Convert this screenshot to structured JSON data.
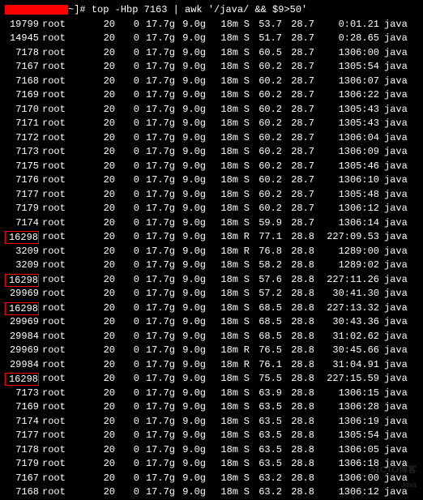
{
  "prompt": {
    "suffix": "~]#",
    "command": "top  -Hbp 7163 | awk '/java/ && $9>50'"
  },
  "rows": [
    {
      "pid": "19799",
      "user": "root",
      "pr": "20",
      "ni": "0",
      "virt": "17.7g",
      "res": "9.0g",
      "shr": "18m",
      "st": "S",
      "cpu": "53.7",
      "mem": "28.7",
      "time": "0:01.21",
      "cmd": "java",
      "hl": false
    },
    {
      "pid": "14945",
      "user": "root",
      "pr": "20",
      "ni": "0",
      "virt": "17.7g",
      "res": "9.0g",
      "shr": "18m",
      "st": "S",
      "cpu": "51.7",
      "mem": "28.7",
      "time": "0:28.65",
      "cmd": "java",
      "hl": false
    },
    {
      "pid": "7178",
      "user": "root",
      "pr": "20",
      "ni": "0",
      "virt": "17.7g",
      "res": "9.0g",
      "shr": "18m",
      "st": "S",
      "cpu": "60.5",
      "mem": "28.7",
      "time": "1306:00",
      "cmd": "java",
      "hl": false
    },
    {
      "pid": "7167",
      "user": "root",
      "pr": "20",
      "ni": "0",
      "virt": "17.7g",
      "res": "9.0g",
      "shr": "18m",
      "st": "S",
      "cpu": "60.2",
      "mem": "28.7",
      "time": "1305:54",
      "cmd": "java",
      "hl": false
    },
    {
      "pid": "7168",
      "user": "root",
      "pr": "20",
      "ni": "0",
      "virt": "17.7g",
      "res": "9.0g",
      "shr": "18m",
      "st": "S",
      "cpu": "60.2",
      "mem": "28.7",
      "time": "1306:07",
      "cmd": "java",
      "hl": false
    },
    {
      "pid": "7169",
      "user": "root",
      "pr": "20",
      "ni": "0",
      "virt": "17.7g",
      "res": "9.0g",
      "shr": "18m",
      "st": "S",
      "cpu": "60.2",
      "mem": "28.7",
      "time": "1306:22",
      "cmd": "java",
      "hl": false
    },
    {
      "pid": "7170",
      "user": "root",
      "pr": "20",
      "ni": "0",
      "virt": "17.7g",
      "res": "9.0g",
      "shr": "18m",
      "st": "S",
      "cpu": "60.2",
      "mem": "28.7",
      "time": "1305:43",
      "cmd": "java",
      "hl": false
    },
    {
      "pid": "7171",
      "user": "root",
      "pr": "20",
      "ni": "0",
      "virt": "17.7g",
      "res": "9.0g",
      "shr": "18m",
      "st": "S",
      "cpu": "60.2",
      "mem": "28.7",
      "time": "1305:43",
      "cmd": "java",
      "hl": false
    },
    {
      "pid": "7172",
      "user": "root",
      "pr": "20",
      "ni": "0",
      "virt": "17.7g",
      "res": "9.0g",
      "shr": "18m",
      "st": "S",
      "cpu": "60.2",
      "mem": "28.7",
      "time": "1306:04",
      "cmd": "java",
      "hl": false
    },
    {
      "pid": "7173",
      "user": "root",
      "pr": "20",
      "ni": "0",
      "virt": "17.7g",
      "res": "9.0g",
      "shr": "18m",
      "st": "S",
      "cpu": "60.2",
      "mem": "28.7",
      "time": "1306:09",
      "cmd": "java",
      "hl": false
    },
    {
      "pid": "7175",
      "user": "root",
      "pr": "20",
      "ni": "0",
      "virt": "17.7g",
      "res": "9.0g",
      "shr": "18m",
      "st": "S",
      "cpu": "60.2",
      "mem": "28.7",
      "time": "1305:46",
      "cmd": "java",
      "hl": false
    },
    {
      "pid": "7176",
      "user": "root",
      "pr": "20",
      "ni": "0",
      "virt": "17.7g",
      "res": "9.0g",
      "shr": "18m",
      "st": "S",
      "cpu": "60.2",
      "mem": "28.7",
      "time": "1306:10",
      "cmd": "java",
      "hl": false
    },
    {
      "pid": "7177",
      "user": "root",
      "pr": "20",
      "ni": "0",
      "virt": "17.7g",
      "res": "9.0g",
      "shr": "18m",
      "st": "S",
      "cpu": "60.2",
      "mem": "28.7",
      "time": "1305:48",
      "cmd": "java",
      "hl": false
    },
    {
      "pid": "7179",
      "user": "root",
      "pr": "20",
      "ni": "0",
      "virt": "17.7g",
      "res": "9.0g",
      "shr": "18m",
      "st": "S",
      "cpu": "60.2",
      "mem": "28.7",
      "time": "1306:12",
      "cmd": "java",
      "hl": false
    },
    {
      "pid": "7174",
      "user": "root",
      "pr": "20",
      "ni": "0",
      "virt": "17.7g",
      "res": "9.0g",
      "shr": "18m",
      "st": "S",
      "cpu": "59.9",
      "mem": "28.7",
      "time": "1306:14",
      "cmd": "java",
      "hl": false
    },
    {
      "pid": "16298",
      "user": "root",
      "pr": "20",
      "ni": "0",
      "virt": "17.7g",
      "res": "9.0g",
      "shr": "18m",
      "st": "R",
      "cpu": "77.1",
      "mem": "28.8",
      "time": "227:09.53",
      "cmd": "java",
      "hl": true
    },
    {
      "pid": "3209",
      "user": "root",
      "pr": "20",
      "ni": "0",
      "virt": "17.7g",
      "res": "9.0g",
      "shr": "18m",
      "st": "R",
      "cpu": "76.8",
      "mem": "28.8",
      "time": "1289:00",
      "cmd": "java",
      "hl": false
    },
    {
      "pid": "3209",
      "user": "root",
      "pr": "20",
      "ni": "0",
      "virt": "17.7g",
      "res": "9.0g",
      "shr": "18m",
      "st": "S",
      "cpu": "58.2",
      "mem": "28.8",
      "time": "1289:02",
      "cmd": "java",
      "hl": false
    },
    {
      "pid": "16298",
      "user": "root",
      "pr": "20",
      "ni": "0",
      "virt": "17.7g",
      "res": "9.0g",
      "shr": "18m",
      "st": "S",
      "cpu": "57.6",
      "mem": "28.8",
      "time": "227:11.26",
      "cmd": "java",
      "hl": true
    },
    {
      "pid": "29969",
      "user": "root",
      "pr": "20",
      "ni": "0",
      "virt": "17.7g",
      "res": "9.0g",
      "shr": "18m",
      "st": "S",
      "cpu": "57.2",
      "mem": "28.8",
      "time": "30:41.30",
      "cmd": "java",
      "hl": false
    },
    {
      "pid": "16298",
      "user": "root",
      "pr": "20",
      "ni": "0",
      "virt": "17.7g",
      "res": "9.0g",
      "shr": "18m",
      "st": "S",
      "cpu": "68.5",
      "mem": "28.8",
      "time": "227:13.32",
      "cmd": "java",
      "hl": true
    },
    {
      "pid": "29969",
      "user": "root",
      "pr": "20",
      "ni": "0",
      "virt": "17.7g",
      "res": "9.0g",
      "shr": "18m",
      "st": "S",
      "cpu": "68.5",
      "mem": "28.8",
      "time": "30:43.36",
      "cmd": "java",
      "hl": false
    },
    {
      "pid": "29984",
      "user": "root",
      "pr": "20",
      "ni": "0",
      "virt": "17.7g",
      "res": "9.0g",
      "shr": "18m",
      "st": "S",
      "cpu": "68.5",
      "mem": "28.8",
      "time": "31:02.62",
      "cmd": "java",
      "hl": false
    },
    {
      "pid": "29969",
      "user": "root",
      "pr": "20",
      "ni": "0",
      "virt": "17.7g",
      "res": "9.0g",
      "shr": "18m",
      "st": "R",
      "cpu": "76.5",
      "mem": "28.8",
      "time": "30:45.66",
      "cmd": "java",
      "hl": false
    },
    {
      "pid": "29984",
      "user": "root",
      "pr": "20",
      "ni": "0",
      "virt": "17.7g",
      "res": "9.0g",
      "shr": "18m",
      "st": "R",
      "cpu": "76.1",
      "mem": "28.8",
      "time": "31:04.91",
      "cmd": "java",
      "hl": false
    },
    {
      "pid": "16298",
      "user": "root",
      "pr": "20",
      "ni": "0",
      "virt": "17.7g",
      "res": "9.0g",
      "shr": "18m",
      "st": "S",
      "cpu": "75.5",
      "mem": "28.8",
      "time": "227:15.59",
      "cmd": "java",
      "hl": true
    },
    {
      "pid": "7173",
      "user": "root",
      "pr": "20",
      "ni": "0",
      "virt": "17.7g",
      "res": "9.0g",
      "shr": "18m",
      "st": "S",
      "cpu": "63.9",
      "mem": "28.8",
      "time": "1306:15",
      "cmd": "java",
      "hl": false
    },
    {
      "pid": "7169",
      "user": "root",
      "pr": "20",
      "ni": "0",
      "virt": "17.7g",
      "res": "9.0g",
      "shr": "18m",
      "st": "S",
      "cpu": "63.5",
      "mem": "28.8",
      "time": "1306:28",
      "cmd": "java",
      "hl": false
    },
    {
      "pid": "7174",
      "user": "root",
      "pr": "20",
      "ni": "0",
      "virt": "17.7g",
      "res": "9.0g",
      "shr": "18m",
      "st": "S",
      "cpu": "63.5",
      "mem": "28.8",
      "time": "1306:19",
      "cmd": "java",
      "hl": false
    },
    {
      "pid": "7177",
      "user": "root",
      "pr": "20",
      "ni": "0",
      "virt": "17.7g",
      "res": "9.0g",
      "shr": "18m",
      "st": "S",
      "cpu": "63.5",
      "mem": "28.8",
      "time": "1305:54",
      "cmd": "java",
      "hl": false
    },
    {
      "pid": "7178",
      "user": "root",
      "pr": "20",
      "ni": "0",
      "virt": "17.7g",
      "res": "9.0g",
      "shr": "18m",
      "st": "S",
      "cpu": "63.5",
      "mem": "28.8",
      "time": "1306:05",
      "cmd": "java",
      "hl": false
    },
    {
      "pid": "7179",
      "user": "root",
      "pr": "20",
      "ni": "0",
      "virt": "17.7g",
      "res": "9.0g",
      "shr": "18m",
      "st": "S",
      "cpu": "63.5",
      "mem": "28.8",
      "time": "1306:18",
      "cmd": "java",
      "hl": false
    },
    {
      "pid": "7167",
      "user": "root",
      "pr": "20",
      "ni": "0",
      "virt": "17.7g",
      "res": "9.0g",
      "shr": "18m",
      "st": "S",
      "cpu": "63.2",
      "mem": "28.8",
      "time": "1306:00",
      "cmd": "java",
      "hl": false
    },
    {
      "pid": "7168",
      "user": "root",
      "pr": "20",
      "ni": "0",
      "virt": "17.7g",
      "res": "9.0g",
      "shr": "18m",
      "st": "S",
      "cpu": "63.2",
      "mem": "28.8",
      "time": "1306:12",
      "cmd": "java",
      "hl": false
    }
  ],
  "watermark": {
    "line1": "51CTO博客",
    "line2": "Java"
  }
}
